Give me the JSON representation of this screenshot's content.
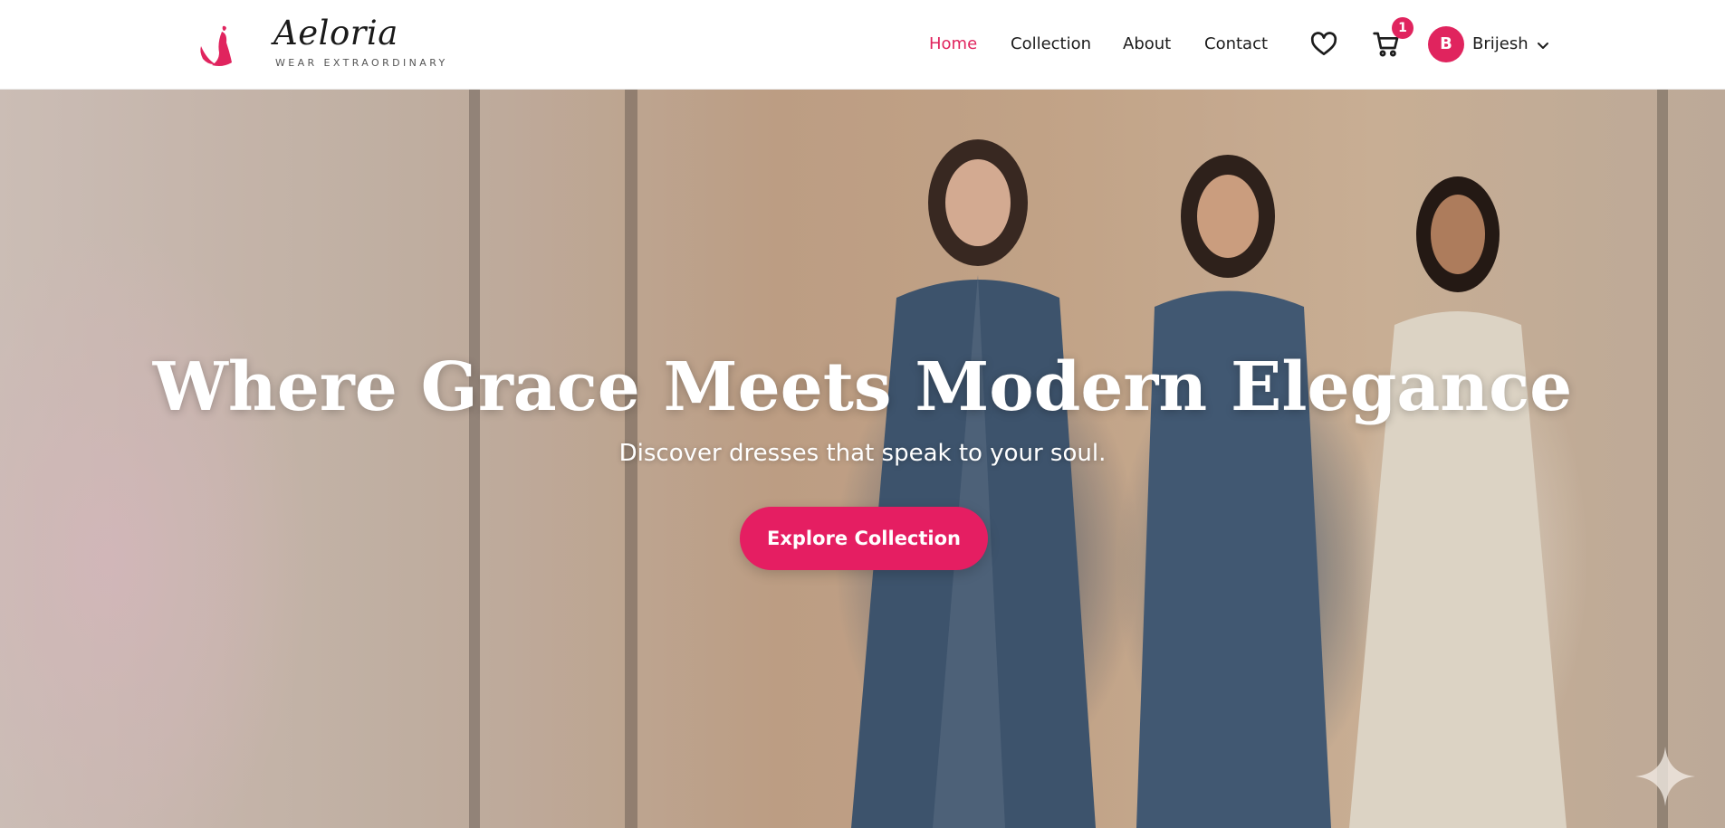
{
  "nav": {
    "brand_name": "Aeloria",
    "brand_tagline": "WEAR EXTRAORDINARY",
    "links": [
      {
        "label": "Home",
        "active": true
      },
      {
        "label": "Collection",
        "active": false
      },
      {
        "label": "About",
        "active": false
      },
      {
        "label": "Contact",
        "active": false
      }
    ],
    "wishlist_icon": "heart-icon",
    "cart_icon": "cart-icon",
    "cart_count": "1",
    "user": {
      "initial": "B",
      "name": "Brijesh",
      "menu_icon": "chevron-down-icon"
    }
  },
  "hero": {
    "title": "Where Grace Meets Modern Elegance",
    "subtitle": "Discover dresses that speak to your soul.",
    "cta_label": "Explore Collection"
  },
  "colors": {
    "accent": "#e0245e",
    "cta": "#e51e62",
    "text": "#1c1c1c"
  }
}
